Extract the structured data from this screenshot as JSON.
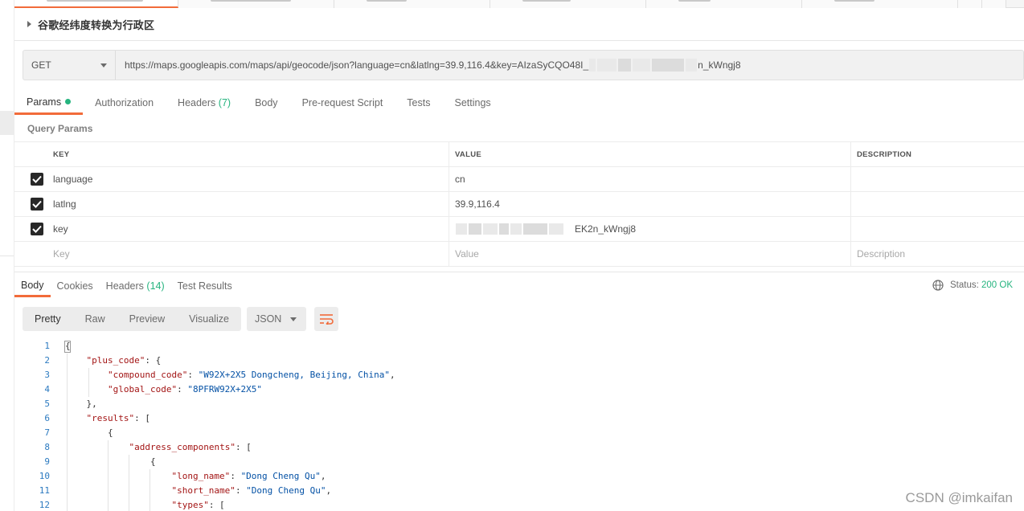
{
  "request": {
    "name": "谷歌经纬度转换为行政区",
    "method": "GET",
    "url_visible_start": "https://maps.googleapis.com/maps/api/geocode/json?language=cn&latlng=39.9,116.4&key=AIzaSyCQO48I_",
    "url_visible_end": "n_kWngj8"
  },
  "request_tabs": [
    {
      "label": "Params",
      "active": true
    },
    {
      "label": "Authorization"
    },
    {
      "label": "Headers",
      "count": "(7)"
    },
    {
      "label": "Body"
    },
    {
      "label": "Pre-request Script"
    },
    {
      "label": "Tests"
    },
    {
      "label": "Settings"
    }
  ],
  "query_params": {
    "label": "Query Params",
    "headers": {
      "key": "KEY",
      "value": "VALUE",
      "description": "DESCRIPTION"
    },
    "rows": [
      {
        "key": "language",
        "value": "cn",
        "checked": true
      },
      {
        "key": "latlng",
        "value": "39.9,116.4",
        "checked": true
      },
      {
        "key": "key",
        "value": "EK2n_kWngj8",
        "checked": true
      }
    ],
    "placeholders": {
      "key": "Key",
      "value": "Value",
      "description": "Description"
    }
  },
  "response_tabs": [
    {
      "label": "Body",
      "active": true
    },
    {
      "label": "Cookies"
    },
    {
      "label": "Headers",
      "count": "(14)"
    },
    {
      "label": "Test Results"
    }
  ],
  "status": {
    "label": "Status:",
    "value": "200 OK",
    "icon": "globe-icon"
  },
  "format_buttons": [
    "Pretty",
    "Raw",
    "Preview",
    "Visualize"
  ],
  "format_selected": "JSON",
  "code_lines": [
    {
      "n": "1",
      "text": "{"
    },
    {
      "n": "2",
      "text": "    \"plus_code\": {"
    },
    {
      "n": "3",
      "text": "        \"compound_code\": \"W92X+2X5 Dongcheng, Beijing, China\","
    },
    {
      "n": "4",
      "text": "        \"global_code\": \"8PFRW92X+2X5\""
    },
    {
      "n": "5",
      "text": "    },"
    },
    {
      "n": "6",
      "text": "    \"results\": ["
    },
    {
      "n": "7",
      "text": "        {"
    },
    {
      "n": "8",
      "text": "            \"address_components\": ["
    },
    {
      "n": "9",
      "text": "                {"
    },
    {
      "n": "10",
      "text": "                    \"long_name\": \"Dong Cheng Qu\","
    },
    {
      "n": "11",
      "text": "                    \"short_name\": \"Dong Cheng Qu\","
    },
    {
      "n": "12",
      "text": "                    \"types\": ["
    }
  ],
  "watermark": "CSDN @imkaifan",
  "colors": {
    "accent": "#f26b3a",
    "green": "#26b47f",
    "json_key": "#a31515",
    "json_string": "#0451a5",
    "line_number": "#2c7ac0"
  }
}
